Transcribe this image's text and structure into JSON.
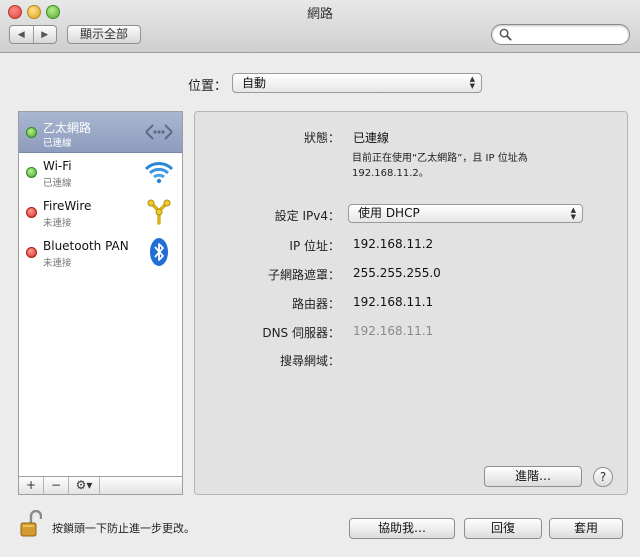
{
  "window": {
    "title": "網路"
  },
  "toolbar": {
    "back_label": "◀",
    "forward_label": "▶",
    "show_all_label": "顯示全部",
    "search_value": ""
  },
  "location": {
    "label": "位置：",
    "value": "自動"
  },
  "services": [
    {
      "name": "乙太網路",
      "status": "已連線",
      "state_color": "green",
      "icon": "ethernet-icon",
      "selected": true
    },
    {
      "name": "Wi-Fi",
      "status": "已連線",
      "state_color": "green",
      "icon": "wifi-icon",
      "selected": false
    },
    {
      "name": "FireWire",
      "status": "未連接",
      "state_color": "red",
      "icon": "firewire-icon",
      "selected": false
    },
    {
      "name": "Bluetooth PAN",
      "status": "未連接",
      "state_color": "red",
      "icon": "bluetooth-icon",
      "selected": false
    }
  ],
  "sidebar_controls": {
    "add": "+",
    "remove": "−",
    "action": "⚙▾"
  },
  "detail": {
    "status_label": "狀態：",
    "status_value": "已連線",
    "status_desc": "目前正在使用“乙太網路”，且 IP 位址為 192.168.11.2。",
    "ipv4_label": "設定 IPv4：",
    "ipv4_value": "使用 DHCP",
    "ip_label": "IP 位址：",
    "ip_value": "192.168.11.2",
    "subnet_label": "子網路遮罩：",
    "subnet_value": "255.255.255.0",
    "router_label": "路由器：",
    "router_value": "192.168.11.1",
    "dns_label": "DNS 伺服器：",
    "dns_value": "192.168.11.1",
    "search_domain_label": "搜尋網域：",
    "search_domain_value": "",
    "advanced_label": "進階…",
    "help_label": "?"
  },
  "footer": {
    "lock_text": "按鎖頭一下防止進一步更改。",
    "assist_label": "協助我…",
    "revert_label": "回復",
    "apply_label": "套用"
  },
  "colors": {
    "selection": "#8d9cbd",
    "connected": "#3da42a",
    "disconnected": "#d3271f",
    "dns_dim": "#8a8a8a"
  }
}
